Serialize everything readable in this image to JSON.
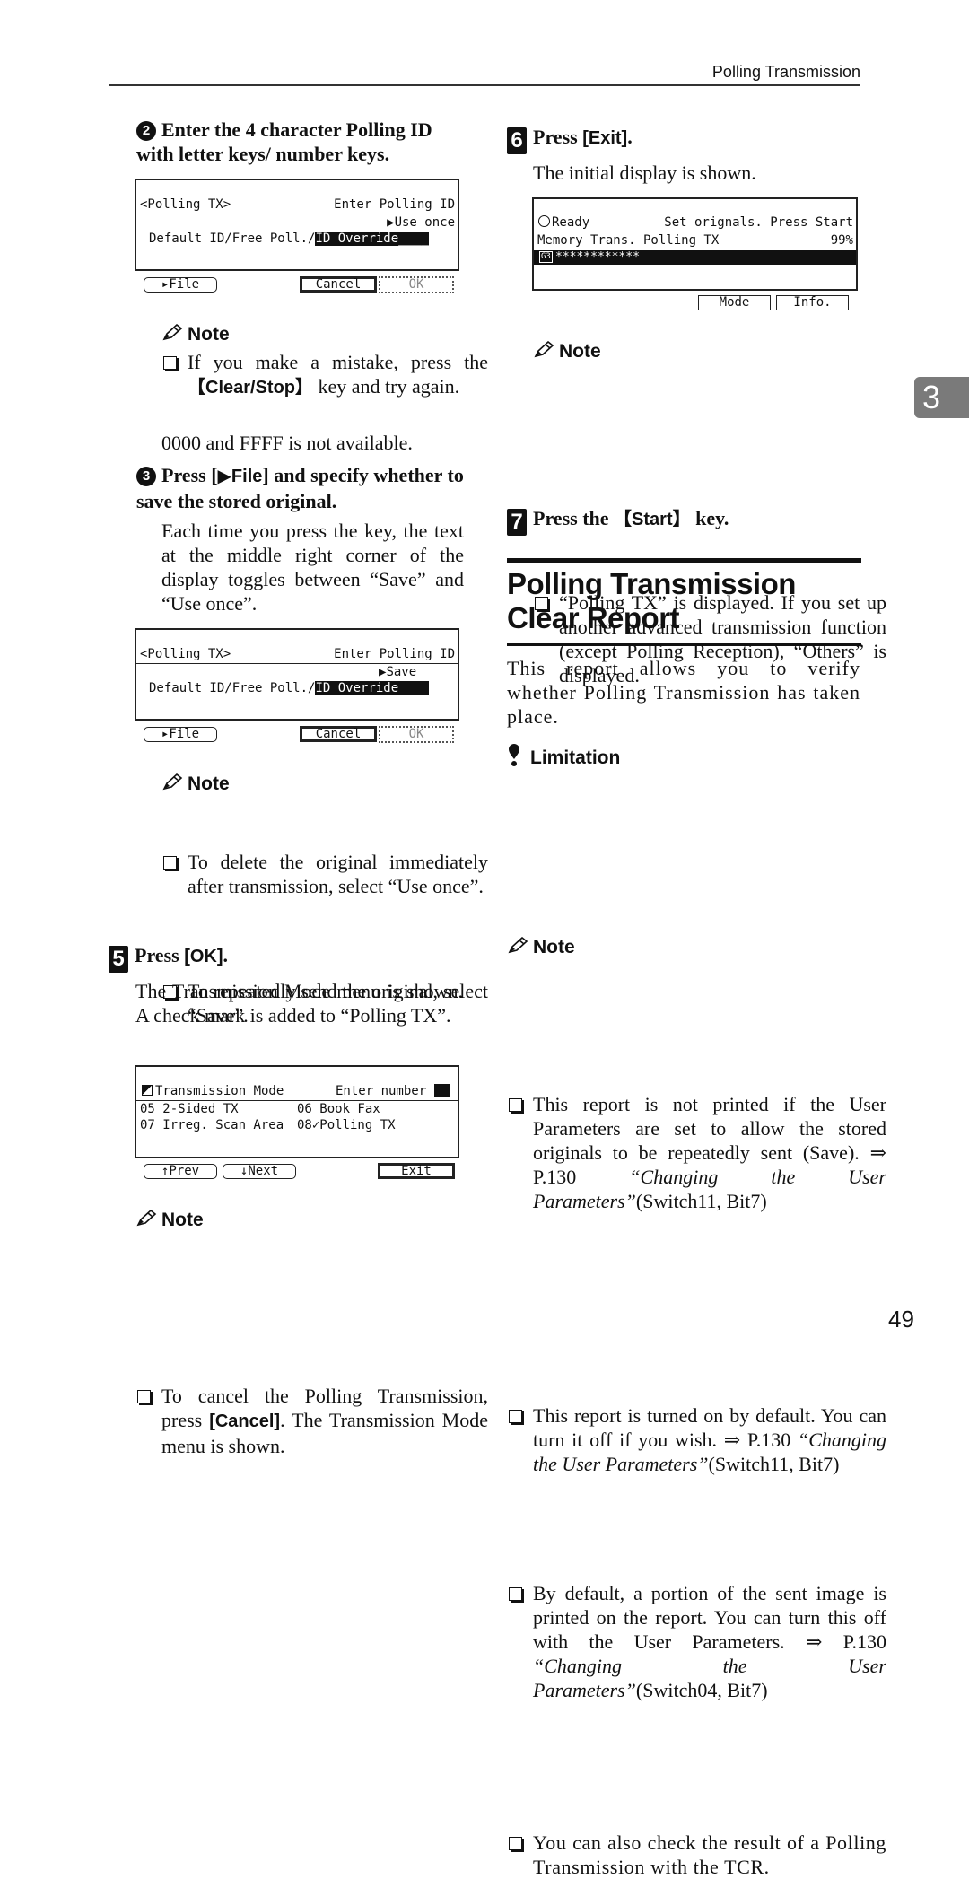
{
  "header": {
    "running_head": "Polling Transmission"
  },
  "chapter_tab": "3",
  "page_number": "49",
  "left_column": {
    "step2": {
      "number": "2",
      "heading": "Enter the 4 character Polling ID with letter keys/ number keys.",
      "screen": {
        "title_left": "<Polling TX>",
        "title_right": "Enter Polling ID",
        "toggle": "Use once",
        "field_label": "Default ID/Free Poll./",
        "field_value": "ID Override____",
        "buttons": {
          "file": "File",
          "cancel": "Cancel",
          "ok": "OK"
        }
      },
      "note": {
        "heading": "Note",
        "items": [
          {
            "pre": "If you make a mistake, press the ",
            "key": "Clear/Stop",
            "post": " key and try again."
          }
        ]
      },
      "after_note": "0000 and FFFF is not available."
    },
    "step3": {
      "number": "3",
      "heading_pre": "Press [",
      "heading_key": "File",
      "heading_post": "] and specify whether to save the stored original.",
      "body": "Each time you press the key, the text at the middle right corner of the display toggles between “Save” and “Use once”.",
      "screen": {
        "title_left": "<Polling TX>",
        "title_right": "Enter Polling ID",
        "toggle": "Save",
        "field_label": "Default ID/Free Poll./",
        "field_value": "ID Override____",
        "buttons": {
          "file": "File",
          "cancel": "Cancel",
          "ok": "OK"
        }
      },
      "note": {
        "heading": "Note",
        "items": [
          "To delete the original immediately after transmission, select “Use once”.",
          "To repeatedly send the original, select “Save”."
        ]
      }
    },
    "step5": {
      "number": "5",
      "heading_pre": "Press ",
      "heading_key": "[OK]",
      "heading_post": ".",
      "body": "The Transmission Mode menu is shown. A check mark is added to “Polling TX”.",
      "screen": {
        "title_left": "Transmission Mode",
        "title_right": "Enter number",
        "rows": [
          {
            "left": "05 2-Sided TX",
            "right": "06 Book Fax"
          },
          {
            "left": "07 Irreg. Scan Area",
            "right": "08✓Polling TX"
          }
        ],
        "buttons": {
          "prev": "↑Prev",
          "next": "↓Next",
          "exit": "Exit"
        }
      },
      "note": {
        "heading": "Note",
        "item_pre": "To cancel the Polling Transmission, press ",
        "item_key": "[Cancel]",
        "item_post": ". The Transmission Mode menu is shown."
      }
    }
  },
  "right_column": {
    "step6": {
      "number": "6",
      "heading_pre": "Press ",
      "heading_key": "[Exit]",
      "heading_post": ".",
      "body": "The initial display is shown.",
      "screen": {
        "status": "Ready",
        "instruction": "Set orignals. Press Start",
        "line2_left": "Memory Trans. Polling TX",
        "line2_right": "99%",
        "line3_badge": "G3",
        "line3_text": "************",
        "buttons": {
          "mode": "Mode",
          "info": "Info."
        }
      },
      "note": {
        "heading": "Note",
        "items": [
          "“Polling TX” is displayed. If you set up another advanced transmission function (except Polling Reception), “Others” is displayed."
        ]
      }
    },
    "step7": {
      "number": "7",
      "heading_pre": "Press the ",
      "heading_key": "Start",
      "heading_post": " key."
    },
    "section": {
      "title": "Polling Transmission Clear Report",
      "intro": "This report allows you to verify whether Polling Transmission has taken place.",
      "limitation": {
        "heading": "Limitation",
        "item_pre": "This report is not printed if the User Parameters are set to allow the stored originals to be repeatedly sent (Save). ⇒ P.130 ",
        "item_ref": "“Changing the User Parameters”",
        "item_post": "(Switch11, Bit7)"
      },
      "note": {
        "heading": "Note",
        "items": [
          {
            "pre": "This report is turned on by default. You can turn it off if you wish. ⇒ P.130 ",
            "ref": "“Changing the User Parameters”",
            "post": "(Switch11, Bit7)"
          },
          {
            "pre": "By default, a portion of the sent image is printed on the report. You can turn this off with the User Parameters. ⇒ P.130 ",
            "ref": "“Changing the User Parameters”",
            "post": "(Switch04, Bit7)"
          },
          {
            "pre": "You can also check the result of a Polling Transmission with the TCR.",
            "ref": "",
            "post": ""
          }
        ]
      }
    }
  }
}
